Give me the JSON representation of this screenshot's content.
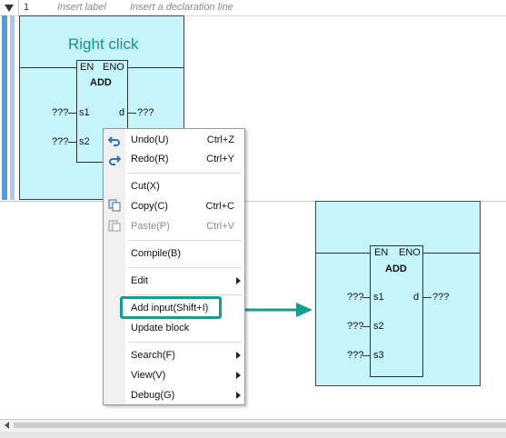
{
  "rung": {
    "number": "1",
    "insert_label": "Insert label",
    "insert_declaration": "Insert a declaration line"
  },
  "left_block": {
    "hint": "Right click",
    "en": "EN",
    "eno": "ENO",
    "name": "ADD",
    "inputs": [
      {
        "pin": "s1",
        "value": "???"
      },
      {
        "pin": "s2",
        "value": "???"
      }
    ],
    "output_pin": "d",
    "output_value": "???"
  },
  "context_menu": {
    "items": [
      {
        "label": "Undo(U)",
        "shortcut": "Ctrl+Z",
        "icon": "undo-icon"
      },
      {
        "label": "Redo(R)",
        "shortcut": "Ctrl+Y",
        "icon": "redo-icon"
      },
      {
        "label": "Cut(X)",
        "shortcut": ""
      },
      {
        "label": "Copy(C)",
        "shortcut": "Ctrl+C",
        "icon": "copy-icon"
      },
      {
        "label": "Paste(P)",
        "shortcut": "Ctrl+V",
        "icon": "paste-icon",
        "disabled": true
      },
      {
        "label": "Compile(B)",
        "shortcut": ""
      },
      {
        "label": "Edit",
        "shortcut": "",
        "submenu": true
      },
      {
        "label": "Add input(Shift+I)",
        "shortcut": "",
        "highlighted": true
      },
      {
        "label": "Update block",
        "shortcut": ""
      },
      {
        "label": "Search(F)",
        "shortcut": "",
        "submenu": true
      },
      {
        "label": "View(V)",
        "shortcut": "",
        "submenu": true
      },
      {
        "label": "Debug(G)",
        "shortcut": "",
        "submenu": true
      }
    ]
  },
  "result_block": {
    "en": "EN",
    "eno": "ENO",
    "name": "ADD",
    "inputs": [
      {
        "pin": "s1",
        "value": "???"
      },
      {
        "pin": "s2",
        "value": "???"
      },
      {
        "pin": "s3",
        "value": "???"
      }
    ],
    "output_pin": "d",
    "output_value": "???"
  },
  "colors": {
    "cell_bg": "#c6f4fb",
    "highlight": "#1a9b8f",
    "hint_text": "#1a8f8f",
    "rail": "#5b9bd5"
  }
}
